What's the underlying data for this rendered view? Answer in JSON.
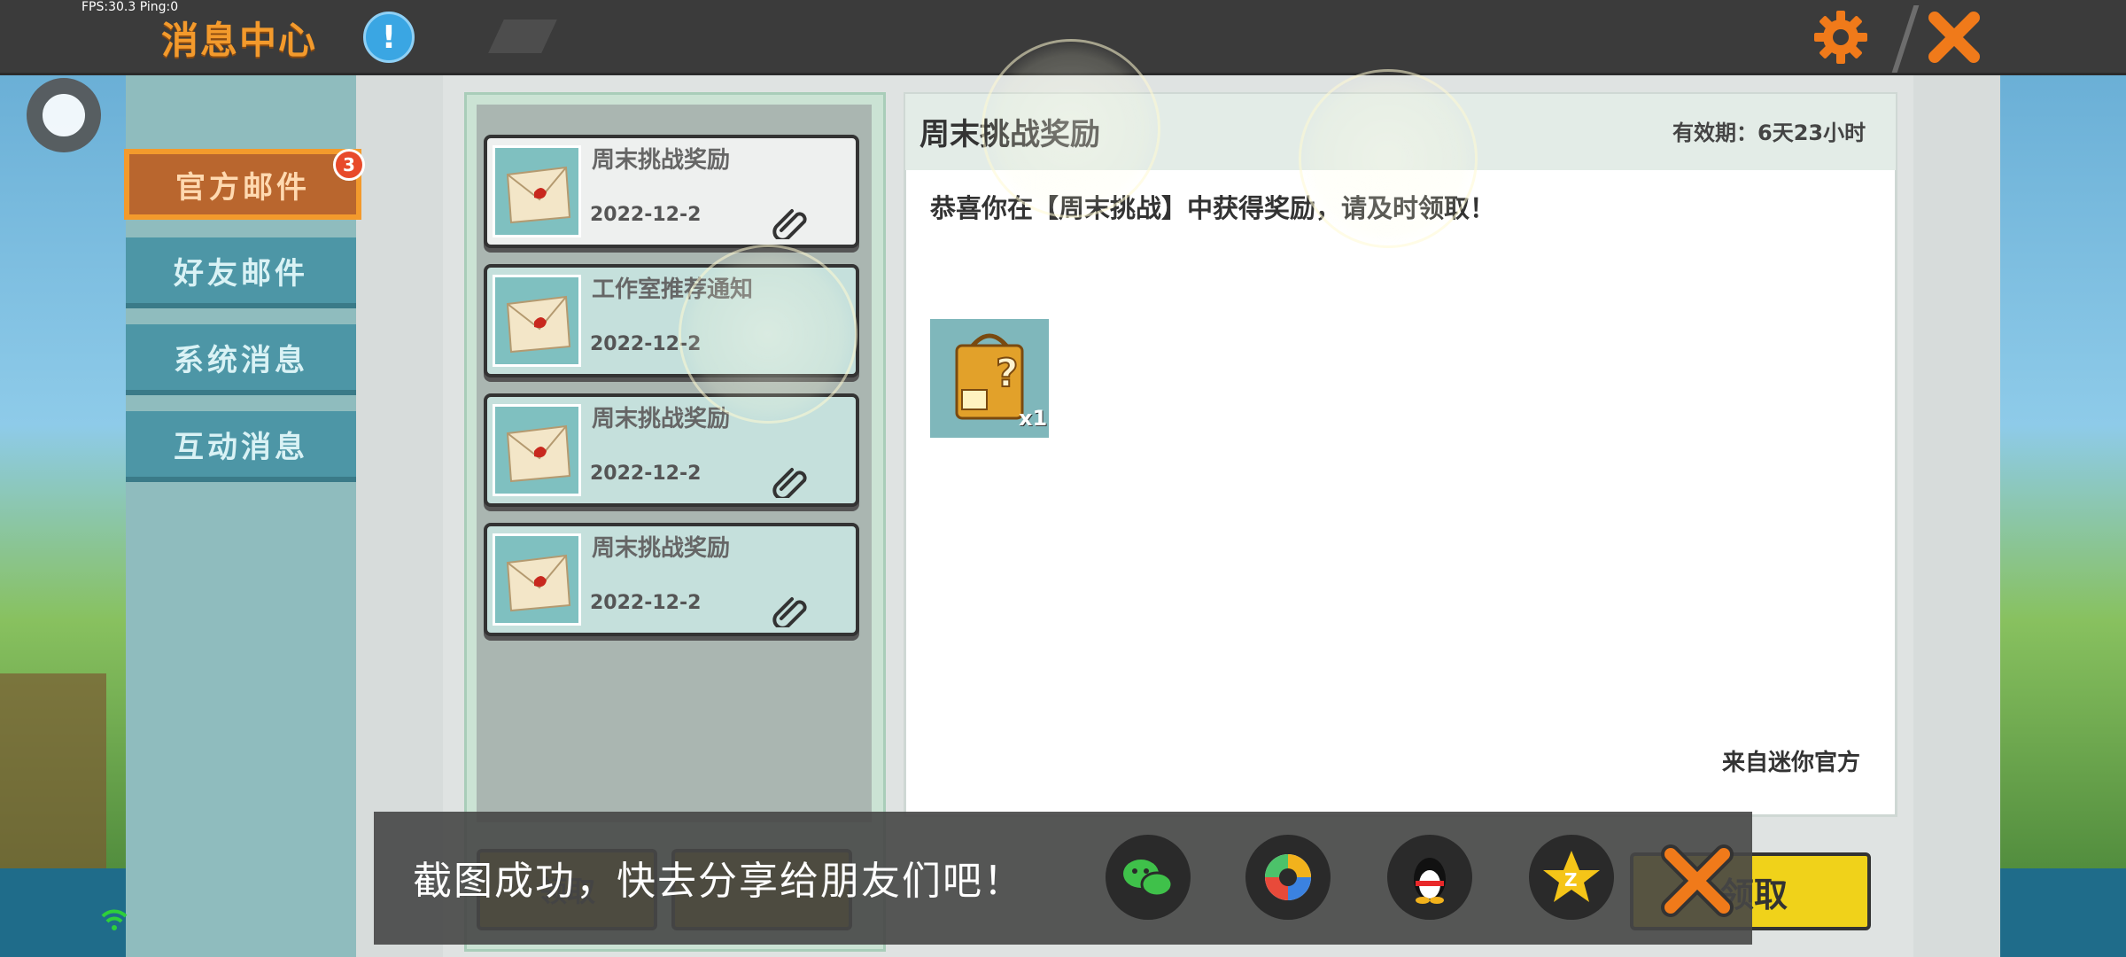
{
  "hud": {
    "fps": "FPS:30.3  Ping:0"
  },
  "header": {
    "title": "消息中心",
    "info_label": "!"
  },
  "tabs": [
    {
      "label": "官方邮件",
      "badge": "3",
      "active": true
    },
    {
      "label": "好友邮件"
    },
    {
      "label": "系统消息"
    },
    {
      "label": "互动消息"
    }
  ],
  "mails": [
    {
      "title": "周末挑战奖励",
      "date": "2022-12-2",
      "has_attachment": true
    },
    {
      "title": "工作室推荐通知",
      "date": "2022-12-2",
      "has_attachment": false
    },
    {
      "title": "周末挑战奖励",
      "date": "2022-12-2",
      "has_attachment": true
    },
    {
      "title": "周末挑战奖励",
      "date": "2022-12-2",
      "has_attachment": true
    }
  ],
  "detail": {
    "title": "周末挑战奖励",
    "validity": "有效期：6天23小时",
    "message": "恭喜你在【周末挑战】中获得奖励，请及时领取！",
    "item_qty": "x1",
    "from": "来自迷你官方"
  },
  "bottom": {
    "btn1": "领取",
    "claim": "领取"
  },
  "share": {
    "text": "截图成功，快去分享给朋友们吧！",
    "targets": [
      "wechat-icon",
      "moments-icon",
      "qq-icon",
      "qzone-icon"
    ]
  },
  "colors": {
    "accent_orange": "#f39a2c",
    "tab_blue": "#4d96a6",
    "claim_yellow": "#f0d21a",
    "badge_red": "#e84a2a"
  }
}
